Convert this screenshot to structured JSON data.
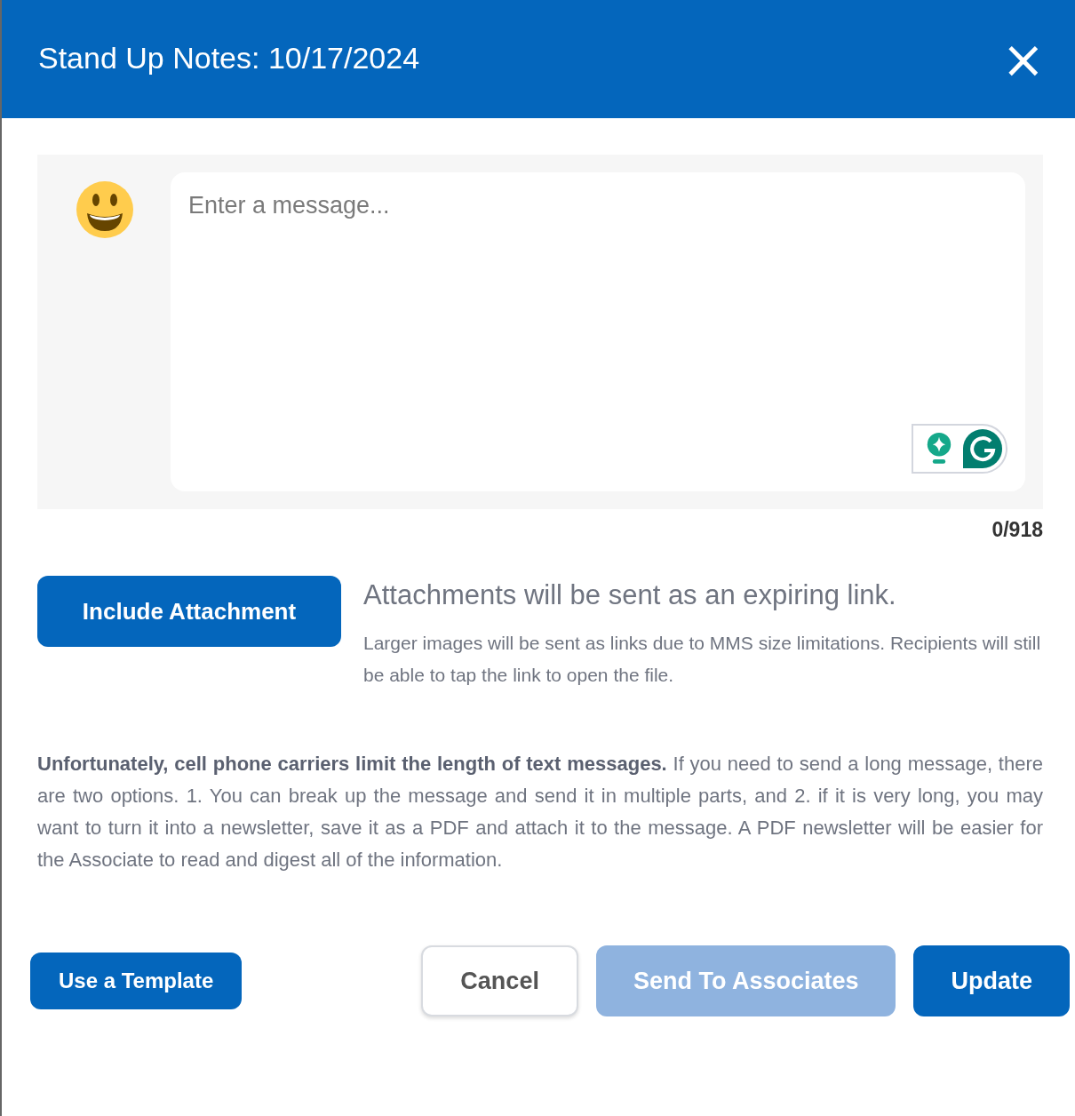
{
  "dialog": {
    "title": "Stand Up Notes: 10/17/2024",
    "close": "×"
  },
  "message": {
    "placeholder": "Enter a message...",
    "counter": "0/918"
  },
  "attachment": {
    "button": "Include Attachment",
    "heading": "Attachments will be sent as an expiring link.",
    "note": "Larger images will be sent as links due to MMS size limitations. Recipients will still be able to tap the link to open the file."
  },
  "notice": "**Unfortunately, cell phone carriers limit the length of text messages.** If you need to send a long message, there are two options. 1. You can break up the message and send it in multiple parts, and 2. if it is very long, you may want to turn it into a newsletter, save it as a PDF and attach it to the message. A PDF newsletter will be easier for the Associate to read and digest all of the information.",
  "footer": {
    "template_button": "Use a Template",
    "buttons": [
      {
        "label": "Cancel",
        "kind": "secondary",
        "disabled": false
      },
      {
        "label": "Send To Associates",
        "kind": "primary",
        "disabled": true
      },
      {
        "label": "Update",
        "kind": "primary",
        "disabled": false
      }
    ]
  }
}
